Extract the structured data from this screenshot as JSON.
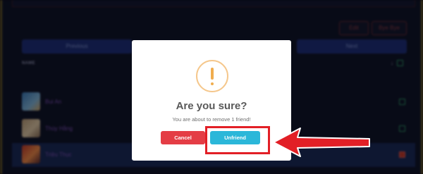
{
  "background": {
    "toolbar": {
      "edit_label": "Edit",
      "bye_label": "Bye Bye"
    },
    "nav": {
      "previous_label": "Previous",
      "next_label": "Next"
    },
    "table": {
      "name_header": "NAME",
      "sort_indicator": "↓",
      "rows": [
        {
          "name": "Bui An",
          "selected": false
        },
        {
          "name": "Thúy Hằng",
          "selected": false
        },
        {
          "name": "Triệu Thục",
          "selected": true
        }
      ]
    }
  },
  "dialog": {
    "icon": "warning-exclamation-icon",
    "title": "Are you sure?",
    "message": "You are about to remove 1 friend!",
    "cancel_label": "Cancel",
    "confirm_label": "Unfriend"
  },
  "colors": {
    "cancel": "#e43d45",
    "confirm": "#2bb7d9",
    "warning": "#f0ad4e",
    "annotation": "#e21f26"
  }
}
